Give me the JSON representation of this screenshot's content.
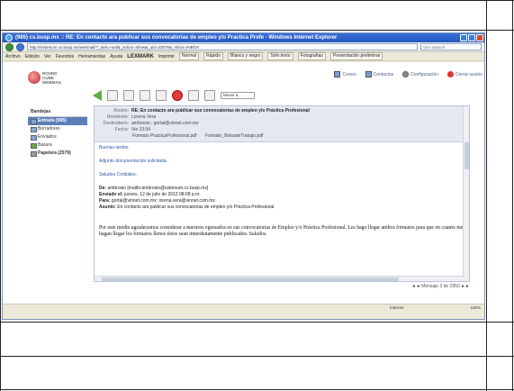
{
  "browser": {
    "title": "(985) cs.busp.mx :: RE: En contacto ara publicar sus convocatorias de empleo y/o Practica Profe - Windows Internet Explorer",
    "address": "http://sistemum.cs.busp.mx/webmail/?_task=mail&_action=show&_uid=33076&_mbox=INBOX",
    "search_placeholder": "Vivo Search",
    "menu": [
      "Archivo",
      "Edición",
      "Ver",
      "Favoritos",
      "Herramientas",
      "Ayuda"
    ],
    "toolbar": {
      "brand": "LEXMARK",
      "items": [
        "Imprimir",
        "Normal",
        "Rápido",
        "Blanco y negro",
        "Sólo texto",
        "Fotografías",
        "Presentación preliminar"
      ]
    },
    "status_zone": "Internet",
    "zoom": "100%"
  },
  "app": {
    "brand_line1": "ROUND",
    "brand_line2": "CUBE",
    "brand_line3": "WEBMAIL",
    "top_links": [
      "Correo",
      "Contactos",
      "Configuración",
      "Cerrar sesión"
    ],
    "move_select": "Mover a..."
  },
  "sidebar": {
    "title": "Bandejas",
    "items": [
      {
        "label": "Entrada (985)"
      },
      {
        "label": "Borradores"
      },
      {
        "label": "Enviados"
      },
      {
        "label": "Basura"
      },
      {
        "label": "Papelera (2579)"
      }
    ]
  },
  "message": {
    "subject_label": "Asunto:",
    "subject": "RE: En contacto ara publicar sus convocatorias de empleo y/o Práctica Profesional",
    "from_label": "Remitente:",
    "from": "Lorena Vera",
    "to_label": "Destinatario:",
    "to": "ambrosio ; gortal@vinnet.com.mx",
    "date_label": "Fecha:",
    "date": "Vie 13:04",
    "attachments": [
      "Formato PracticaProfesional.pdf",
      "Formato_BolsadeTrabajo.pdf"
    ],
    "greeting": "Buenas tardes:",
    "line1": "Adjunto documentación solicitada.",
    "signoff": "Saludos Cordiales.",
    "quote_de_label": "De:",
    "quote_de": "ambrosio [mailto:ambrosio@sistenum.cs.busp.mx]",
    "quote_enviado_label": "Enviado el:",
    "quote_enviado": "jueves, 12 de julio de 2012 08:08 p.m.",
    "quote_para_label": "Para:",
    "quote_para": "gortal@vinnet.com.mx; lorena.vera@vinnet.com.mx",
    "quote_asunto_label": "Asunto:",
    "quote_asunto": "En contacto ara publicar sus convocatorias de empleo y/o Práctica Profesional",
    "body_text": "Por este medio agradecemos considerar a nuestros egresados en sus convocatorias de Empleo y/o Práctica Profesional. Les hago llegar ambos formatos para que en cuanto me hagan llegar los formatos llenos éstos sean inmediatamente publicados. Saludos."
  },
  "pager": "◄◄ Mensaje 3 de 2950 ►►"
}
